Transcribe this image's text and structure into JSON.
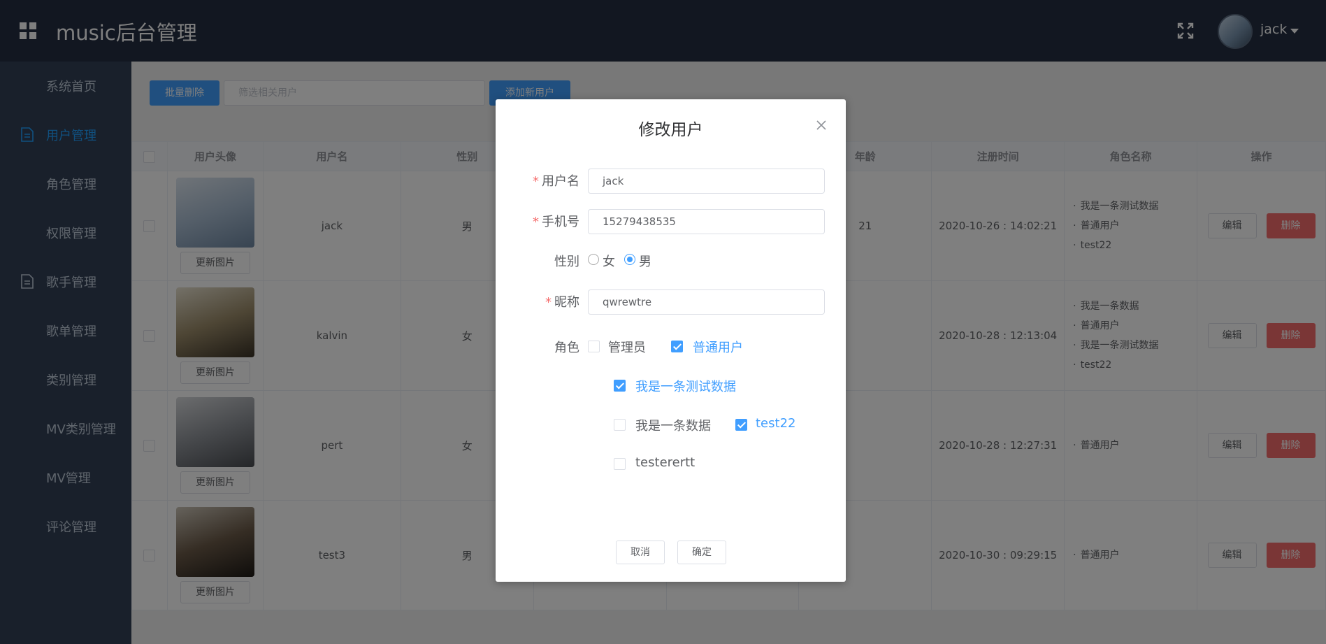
{
  "header": {
    "logo": "music后台管理",
    "user_name": "jack",
    "menu_icon": "grid-icon",
    "fullscreen_icon": "fullscreen-icon"
  },
  "sidebar": {
    "items": [
      {
        "label": "系统首页"
      },
      {
        "label": "用户管理",
        "icon": "document-icon",
        "active": true
      },
      {
        "label": "角色管理"
      },
      {
        "label": "权限管理"
      },
      {
        "label": "歌手管理",
        "icon": "document-icon"
      },
      {
        "label": "歌单管理"
      },
      {
        "label": "类别管理"
      },
      {
        "label": "MV类别管理"
      },
      {
        "label": "MV管理"
      },
      {
        "label": "评论管理"
      }
    ]
  },
  "toolbar": {
    "batch_delete": "批量删除",
    "filter_placeholder": "筛选相关用户",
    "add_user": "添加新用户"
  },
  "table": {
    "columns": [
      "用户头像",
      "用户名",
      "性别",
      "",
      "",
      "年龄",
      "注册时间",
      "角色名称",
      "操作"
    ],
    "update_photo_label": "更新图片",
    "edit_label": "编辑",
    "delete_label": "删除",
    "rows": [
      {
        "username": "jack",
        "gender": "男",
        "age": "21",
        "registered": "2020-10-26 : 14:02:21",
        "roles": [
          "我是一条测试数据",
          "普通用户",
          "test22"
        ]
      },
      {
        "username": "kalvin",
        "gender": "女",
        "age": "",
        "registered": "2020-10-28 : 12:13:04",
        "roles": [
          "我是一条数据",
          "普通用户",
          "我是一条测试数据",
          "test22"
        ]
      },
      {
        "username": "pert",
        "gender": "女",
        "age": "",
        "registered": "2020-10-28 : 12:27:31",
        "roles": [
          "普通用户"
        ]
      },
      {
        "username": "test3",
        "gender": "男",
        "age": "",
        "registered": "2020-10-30 : 09:29:15",
        "roles": [
          "普通用户"
        ]
      }
    ]
  },
  "dialog": {
    "title": "修改用户",
    "username_label": "用户名",
    "username_value": "jack",
    "phone_label": "手机号",
    "phone_value": "15279438535",
    "gender_label": "性别",
    "gender_female": "女",
    "gender_male": "男",
    "gender_selected": "男",
    "nickname_label": "昵称",
    "nickname_value": "qwrewtre",
    "role_label": "角色",
    "roles": [
      {
        "label": "管理员",
        "checked": false
      },
      {
        "label": "普通用户",
        "checked": true
      },
      {
        "label": "我是一条测试数据",
        "checked": true
      },
      {
        "label": "我是一条数据",
        "checked": false
      },
      {
        "label": "test22",
        "checked": true
      },
      {
        "label": "testerertt",
        "checked": false
      }
    ],
    "cancel_label": "取消",
    "confirm_label": "确定"
  },
  "colors": {
    "header_bg": "#242f42",
    "sidebar_bg": "#324157",
    "accent": "#409eff",
    "danger": "#f56c6c"
  }
}
